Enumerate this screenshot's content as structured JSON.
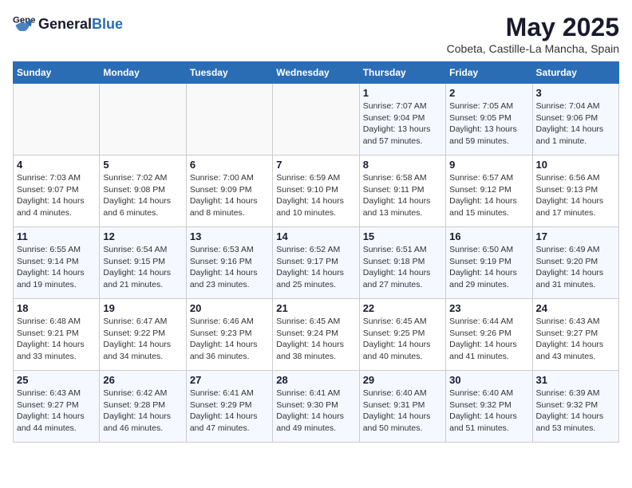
{
  "header": {
    "logo_general": "General",
    "logo_blue": "Blue",
    "title": "May 2025",
    "subtitle": "Cobeta, Castille-La Mancha, Spain"
  },
  "days_of_week": [
    "Sunday",
    "Monday",
    "Tuesday",
    "Wednesday",
    "Thursday",
    "Friday",
    "Saturday"
  ],
  "weeks": [
    [
      {
        "day": "",
        "info": ""
      },
      {
        "day": "",
        "info": ""
      },
      {
        "day": "",
        "info": ""
      },
      {
        "day": "",
        "info": ""
      },
      {
        "day": "1",
        "info": "Sunrise: 7:07 AM\nSunset: 9:04 PM\nDaylight: 13 hours\nand 57 minutes."
      },
      {
        "day": "2",
        "info": "Sunrise: 7:05 AM\nSunset: 9:05 PM\nDaylight: 13 hours\nand 59 minutes."
      },
      {
        "day": "3",
        "info": "Sunrise: 7:04 AM\nSunset: 9:06 PM\nDaylight: 14 hours\nand 1 minute."
      }
    ],
    [
      {
        "day": "4",
        "info": "Sunrise: 7:03 AM\nSunset: 9:07 PM\nDaylight: 14 hours\nand 4 minutes."
      },
      {
        "day": "5",
        "info": "Sunrise: 7:02 AM\nSunset: 9:08 PM\nDaylight: 14 hours\nand 6 minutes."
      },
      {
        "day": "6",
        "info": "Sunrise: 7:00 AM\nSunset: 9:09 PM\nDaylight: 14 hours\nand 8 minutes."
      },
      {
        "day": "7",
        "info": "Sunrise: 6:59 AM\nSunset: 9:10 PM\nDaylight: 14 hours\nand 10 minutes."
      },
      {
        "day": "8",
        "info": "Sunrise: 6:58 AM\nSunset: 9:11 PM\nDaylight: 14 hours\nand 13 minutes."
      },
      {
        "day": "9",
        "info": "Sunrise: 6:57 AM\nSunset: 9:12 PM\nDaylight: 14 hours\nand 15 minutes."
      },
      {
        "day": "10",
        "info": "Sunrise: 6:56 AM\nSunset: 9:13 PM\nDaylight: 14 hours\nand 17 minutes."
      }
    ],
    [
      {
        "day": "11",
        "info": "Sunrise: 6:55 AM\nSunset: 9:14 PM\nDaylight: 14 hours\nand 19 minutes."
      },
      {
        "day": "12",
        "info": "Sunrise: 6:54 AM\nSunset: 9:15 PM\nDaylight: 14 hours\nand 21 minutes."
      },
      {
        "day": "13",
        "info": "Sunrise: 6:53 AM\nSunset: 9:16 PM\nDaylight: 14 hours\nand 23 minutes."
      },
      {
        "day": "14",
        "info": "Sunrise: 6:52 AM\nSunset: 9:17 PM\nDaylight: 14 hours\nand 25 minutes."
      },
      {
        "day": "15",
        "info": "Sunrise: 6:51 AM\nSunset: 9:18 PM\nDaylight: 14 hours\nand 27 minutes."
      },
      {
        "day": "16",
        "info": "Sunrise: 6:50 AM\nSunset: 9:19 PM\nDaylight: 14 hours\nand 29 minutes."
      },
      {
        "day": "17",
        "info": "Sunrise: 6:49 AM\nSunset: 9:20 PM\nDaylight: 14 hours\nand 31 minutes."
      }
    ],
    [
      {
        "day": "18",
        "info": "Sunrise: 6:48 AM\nSunset: 9:21 PM\nDaylight: 14 hours\nand 33 minutes."
      },
      {
        "day": "19",
        "info": "Sunrise: 6:47 AM\nSunset: 9:22 PM\nDaylight: 14 hours\nand 34 minutes."
      },
      {
        "day": "20",
        "info": "Sunrise: 6:46 AM\nSunset: 9:23 PM\nDaylight: 14 hours\nand 36 minutes."
      },
      {
        "day": "21",
        "info": "Sunrise: 6:45 AM\nSunset: 9:24 PM\nDaylight: 14 hours\nand 38 minutes."
      },
      {
        "day": "22",
        "info": "Sunrise: 6:45 AM\nSunset: 9:25 PM\nDaylight: 14 hours\nand 40 minutes."
      },
      {
        "day": "23",
        "info": "Sunrise: 6:44 AM\nSunset: 9:26 PM\nDaylight: 14 hours\nand 41 minutes."
      },
      {
        "day": "24",
        "info": "Sunrise: 6:43 AM\nSunset: 9:27 PM\nDaylight: 14 hours\nand 43 minutes."
      }
    ],
    [
      {
        "day": "25",
        "info": "Sunrise: 6:43 AM\nSunset: 9:27 PM\nDaylight: 14 hours\nand 44 minutes."
      },
      {
        "day": "26",
        "info": "Sunrise: 6:42 AM\nSunset: 9:28 PM\nDaylight: 14 hours\nand 46 minutes."
      },
      {
        "day": "27",
        "info": "Sunrise: 6:41 AM\nSunset: 9:29 PM\nDaylight: 14 hours\nand 47 minutes."
      },
      {
        "day": "28",
        "info": "Sunrise: 6:41 AM\nSunset: 9:30 PM\nDaylight: 14 hours\nand 49 minutes."
      },
      {
        "day": "29",
        "info": "Sunrise: 6:40 AM\nSunset: 9:31 PM\nDaylight: 14 hours\nand 50 minutes."
      },
      {
        "day": "30",
        "info": "Sunrise: 6:40 AM\nSunset: 9:32 PM\nDaylight: 14 hours\nand 51 minutes."
      },
      {
        "day": "31",
        "info": "Sunrise: 6:39 AM\nSunset: 9:32 PM\nDaylight: 14 hours\nand 53 minutes."
      }
    ]
  ]
}
